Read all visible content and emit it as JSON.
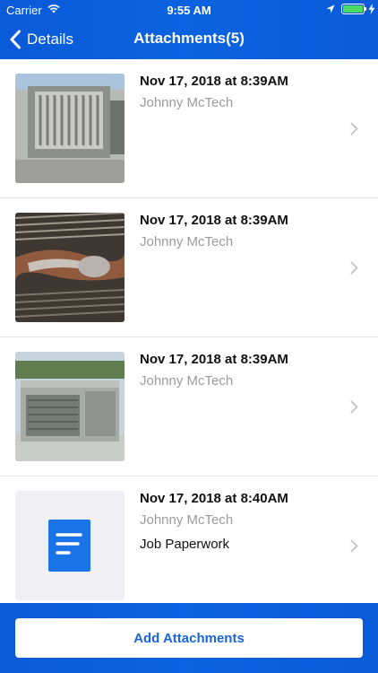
{
  "status_bar": {
    "carrier": "Carrier",
    "time": "9:55 AM"
  },
  "nav": {
    "back_label": "Details",
    "title": "Attachments(5)"
  },
  "attachments": [
    {
      "date": "Nov 17, 2018 at 8:39AM",
      "author": "Johnny McTech",
      "note": "",
      "type": "photo"
    },
    {
      "date": "Nov 17, 2018 at 8:39AM",
      "author": "Johnny McTech",
      "note": "",
      "type": "photo"
    },
    {
      "date": "Nov 17, 2018 at 8:39AM",
      "author": "Johnny McTech",
      "note": "",
      "type": "photo"
    },
    {
      "date": "Nov 17, 2018 at 8:40AM",
      "author": "Johnny McTech",
      "note": "Job Paperwork",
      "type": "document"
    }
  ],
  "footer": {
    "add_button_label": "Add Attachments"
  },
  "colors": {
    "header_blue": "#0b63e0",
    "doc_icon_blue": "#1a73e8",
    "button_text": "#1a64d6",
    "battery_green": "#4cd964"
  },
  "icons": [
    "wifi-icon",
    "location-icon",
    "battery-icon",
    "charging-icon",
    "back-chevron-icon",
    "chevron-right-icon",
    "document-icon"
  ]
}
